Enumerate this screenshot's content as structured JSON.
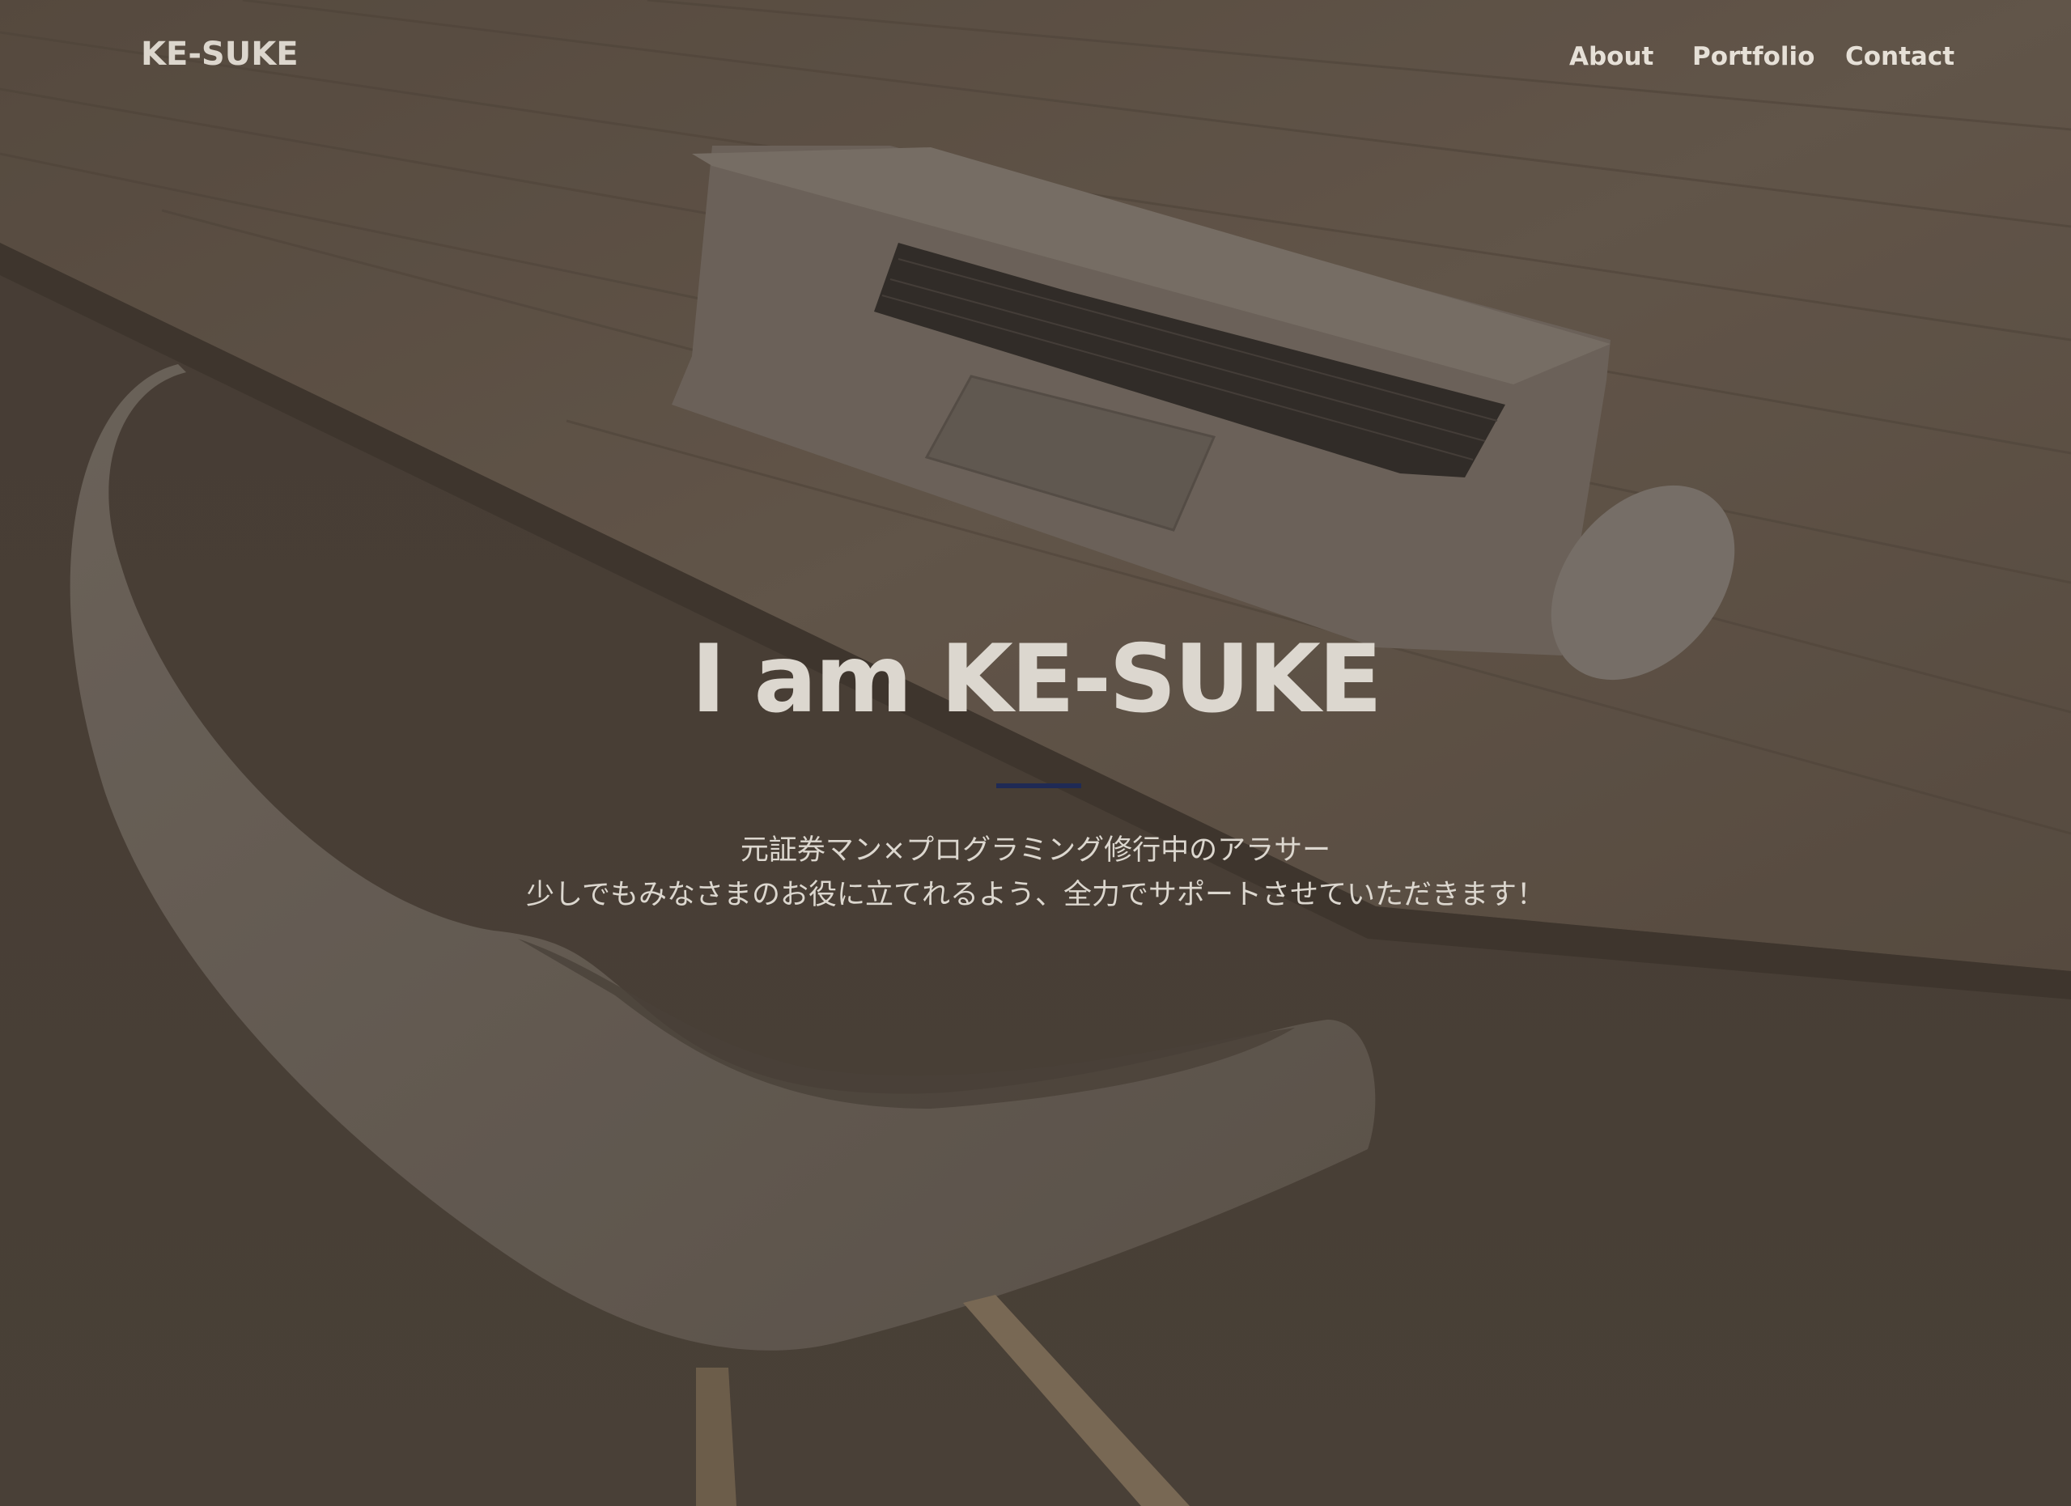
{
  "header": {
    "brand": "KE-SUKE",
    "nav": [
      {
        "label": "About"
      },
      {
        "label": "Portfolio"
      },
      {
        "label": "Contact"
      }
    ]
  },
  "hero": {
    "title": "I am KE-SUKE",
    "tagline_line1": "元証券マン×プログラミング修行中のアラサー",
    "tagline_line2": "少しでもみなさまのお役に立てれるよう、全力でサポートさせていただきます！"
  },
  "colors": {
    "overlay": "#4c4239",
    "accent_divider": "#1f2a55",
    "text": "#dcd7cf"
  }
}
